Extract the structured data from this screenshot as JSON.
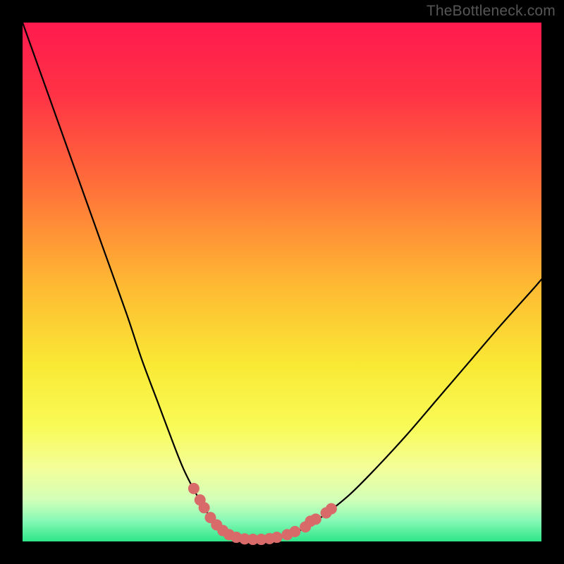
{
  "watermark": "TheBottleneck.com",
  "chart_data": {
    "type": "line",
    "title": "",
    "xlabel": "",
    "ylabel": "",
    "xlim": [
      0,
      100
    ],
    "ylim": [
      0,
      100
    ],
    "grid": false,
    "legend": false,
    "background_gradient": {
      "stops": [
        {
          "pos": 0.0,
          "color": "#ff1a4e"
        },
        {
          "pos": 0.14,
          "color": "#ff3345"
        },
        {
          "pos": 0.3,
          "color": "#ff6a3a"
        },
        {
          "pos": 0.5,
          "color": "#ffb733"
        },
        {
          "pos": 0.66,
          "color": "#f9e934"
        },
        {
          "pos": 0.78,
          "color": "#f9fb58"
        },
        {
          "pos": 0.86,
          "color": "#f3fe9a"
        },
        {
          "pos": 0.92,
          "color": "#d2ffb8"
        },
        {
          "pos": 0.96,
          "color": "#86f9b6"
        },
        {
          "pos": 1.0,
          "color": "#2fe58a"
        }
      ]
    },
    "series": [
      {
        "name": "bottleneck-curve",
        "color": "#000000",
        "x": [
          0,
          5,
          10,
          15,
          20,
          23,
          26,
          29,
          31,
          33,
          35,
          36.5,
          38,
          39.5,
          41,
          43,
          46,
          50,
          54,
          58,
          63,
          68,
          74,
          80,
          86,
          92,
          98,
          100
        ],
        "y": [
          100,
          86,
          72,
          58,
          44,
          35,
          27,
          19,
          14,
          10,
          6.5,
          4.2,
          2.6,
          1.5,
          0.8,
          0.4,
          0.4,
          0.9,
          2.4,
          5.0,
          9.0,
          14.0,
          20.5,
          27.5,
          34.5,
          41.5,
          48.2,
          50.5
        ]
      }
    ],
    "markers": {
      "name": "highlight-points",
      "color": "#d86a6a",
      "radius_abs": 8,
      "points": [
        {
          "x": 33.0,
          "y": 10.2
        },
        {
          "x": 34.2,
          "y": 8.0
        },
        {
          "x": 35.0,
          "y": 6.5
        },
        {
          "x": 36.2,
          "y": 4.6
        },
        {
          "x": 37.4,
          "y": 3.2
        },
        {
          "x": 38.6,
          "y": 2.1
        },
        {
          "x": 39.8,
          "y": 1.3
        },
        {
          "x": 41.2,
          "y": 0.8
        },
        {
          "x": 42.8,
          "y": 0.5
        },
        {
          "x": 44.4,
          "y": 0.4
        },
        {
          "x": 46.0,
          "y": 0.4
        },
        {
          "x": 47.6,
          "y": 0.55
        },
        {
          "x": 49.0,
          "y": 0.8
        },
        {
          "x": 51.0,
          "y": 1.3
        },
        {
          "x": 52.5,
          "y": 1.9
        },
        {
          "x": 54.5,
          "y": 2.8
        },
        {
          "x": 55.5,
          "y": 3.9
        },
        {
          "x": 56.5,
          "y": 4.3
        },
        {
          "x": 58.5,
          "y": 5.5
        },
        {
          "x": 59.5,
          "y": 6.3
        }
      ]
    }
  }
}
